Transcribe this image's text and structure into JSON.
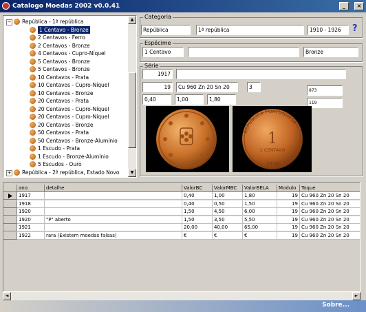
{
  "window": {
    "title": "Catalogo Moedas 2002  v0.0.41"
  },
  "tree": {
    "items": [
      {
        "label": "República - 1ª república",
        "level": 0,
        "type": "folder"
      },
      {
        "label": "1 Centavo - Bronze",
        "level": 1,
        "type": "coin",
        "selected": true
      },
      {
        "label": "2 Centavos - Ferro",
        "level": 1,
        "type": "coin"
      },
      {
        "label": "2 Centavos - Bronze",
        "level": 1,
        "type": "coin"
      },
      {
        "label": "4 Centavos - Cupro-Níquel",
        "level": 1,
        "type": "coin"
      },
      {
        "label": "5 Centavos - Bronze",
        "level": 1,
        "type": "coin"
      },
      {
        "label": "5 Centavos - Bronze",
        "level": 1,
        "type": "coin"
      },
      {
        "label": "10 Centavos - Prata",
        "level": 1,
        "type": "coin"
      },
      {
        "label": "10 Centavos - Cupro-Níquel",
        "level": 1,
        "type": "coin"
      },
      {
        "label": "10 Centavos - Bronze",
        "level": 1,
        "type": "coin"
      },
      {
        "label": "20 Centavos - Prata",
        "level": 1,
        "type": "coin"
      },
      {
        "label": "20 Centavos - Cupro-Níquel",
        "level": 1,
        "type": "coin"
      },
      {
        "label": "20 Centavos - Cupro-Níquel",
        "level": 1,
        "type": "coin"
      },
      {
        "label": "20 Centavos - Bronze",
        "level": 1,
        "type": "coin"
      },
      {
        "label": "50 Centavos - Prata",
        "level": 1,
        "type": "coin"
      },
      {
        "label": "50 Centavos - Bronze-Alumínio",
        "level": 1,
        "type": "coin"
      },
      {
        "label": "1 Escudo - Prata",
        "level": 1,
        "type": "coin"
      },
      {
        "label": "1 Escudo - Bronze-Alumínio",
        "level": 1,
        "type": "coin"
      },
      {
        "label": "5 Escudos - Ouro",
        "level": 1,
        "type": "coin"
      },
      {
        "label": "República - 2ª república, Estado Novo",
        "level": 0,
        "type": "folder"
      }
    ]
  },
  "categoria": {
    "label": "Categoria",
    "country": "República",
    "period": "1ª república",
    "years": "1910 - 1926",
    "help": "?"
  },
  "especime": {
    "label": "Espécime",
    "denomination": "1 Centavo",
    "extra": "",
    "metal": "Bronze"
  },
  "serie": {
    "label": "Série",
    "year": "1917",
    "note": "",
    "module": "19",
    "composition": "Cu 960 Zn 20  Sn 20",
    "value3": "3",
    "price_bc": "0,40",
    "price_mbc": "1,00",
    "price_bela": "1,80",
    "ref1": "873",
    "ref2": "119"
  },
  "coin_images": {
    "obverse_label": "1 CENTAVO",
    "reverse_text_top": "REPUBLICA PORTUGUESA",
    "reverse_year": "1918"
  },
  "table": {
    "columns": [
      "ano",
      "detalhe",
      "ValorBC",
      "ValorMBC",
      "ValorBELA",
      "Modulo",
      "Toque"
    ],
    "rows": [
      [
        "1917",
        "",
        "0,40",
        "1,00",
        "1,80",
        "19",
        "Cu 960 Zn 20  Sn 20"
      ],
      [
        "1918",
        "",
        "0,40",
        "0,50",
        "1,50",
        "19",
        "Cu 960 Zn 20  Sn 20"
      ],
      [
        "1920",
        "",
        "1,50",
        "4,50",
        "6,00",
        "19",
        "Cu 960 Zn 20  Sn 20"
      ],
      [
        "1920",
        "\"P\" aberto",
        "1,50",
        "3,50",
        "5,50",
        "19",
        "Cu 960 Zn 20  Sn 20"
      ],
      [
        "1921",
        "",
        "20,00",
        "40,00",
        "65,00",
        "19",
        "Cu 960 Zn 20  Sn 20"
      ],
      [
        "1922",
        "rara (Existem moedas falsas)",
        "€",
        "€",
        "€",
        "19",
        "Cu 960 Zn 20  Sn 20"
      ]
    ]
  },
  "status": {
    "link": "Sobre..."
  }
}
